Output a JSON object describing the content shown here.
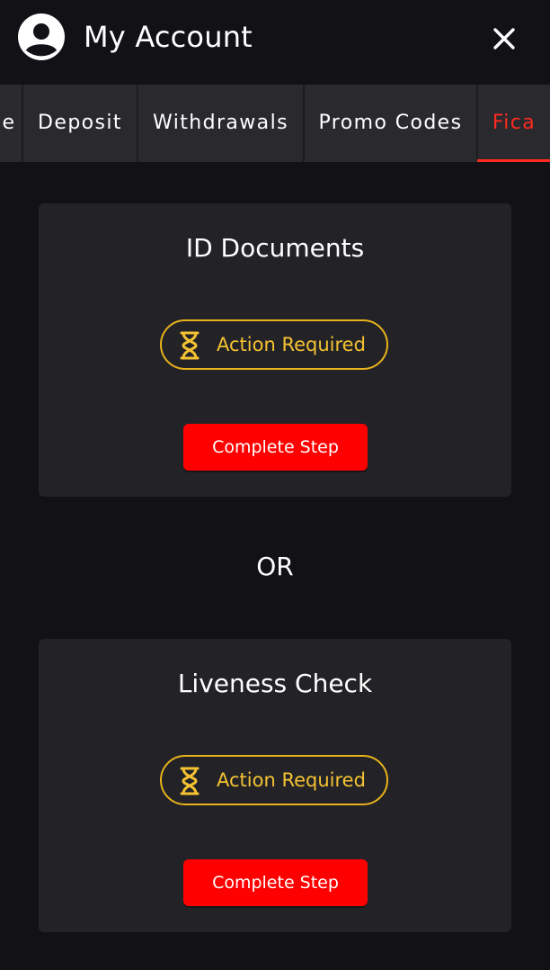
{
  "header": {
    "title": "My Account",
    "avatar_icon": "user-circle-icon",
    "close_icon": "close-icon"
  },
  "tabs": [
    {
      "label": "e",
      "active": false
    },
    {
      "label": "Deposit",
      "active": false
    },
    {
      "label": "Withdrawals",
      "active": false
    },
    {
      "label": "Promo Codes",
      "active": false
    },
    {
      "label": "Fica",
      "active": true
    }
  ],
  "cards": [
    {
      "title": "ID Documents",
      "status": "Action Required",
      "status_icon": "hourglass-icon",
      "button_label": "Complete Step"
    },
    {
      "title": "Liveness Check",
      "status": "Action Required",
      "status_icon": "hourglass-icon",
      "button_label": "Complete Step"
    }
  ],
  "separator_text": "OR",
  "colors": {
    "accent": "#ff2a1f",
    "button": "#ff0000",
    "warning": "#f5c232",
    "background": "#111116",
    "card": "#232327",
    "tabbar": "#2a2a2e"
  }
}
